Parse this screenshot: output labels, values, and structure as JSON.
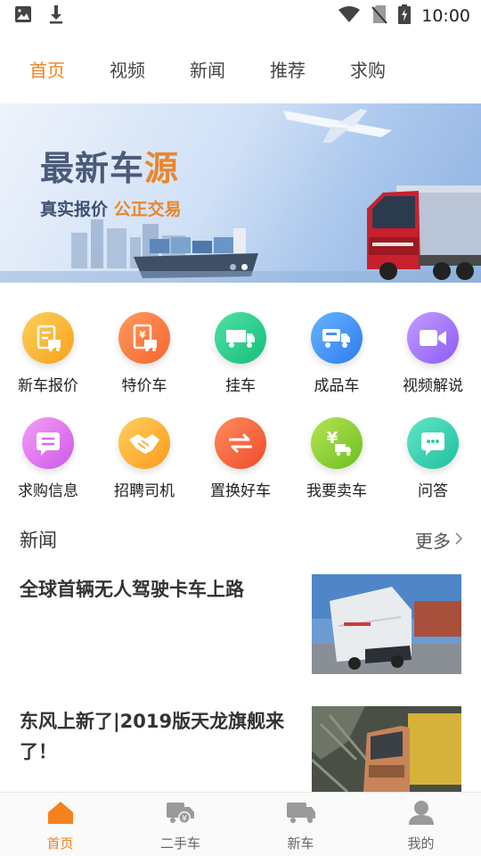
{
  "status_bar": {
    "time": "10:00"
  },
  "top_tabs": [
    "首页",
    "视频",
    "新闻",
    "推荐",
    "求购"
  ],
  "banner": {
    "title_main": "最新车",
    "title_accent": "源",
    "subtitle_main": "真实报价  ",
    "subtitle_accent": "公正交易"
  },
  "features": [
    {
      "label": "新车报价",
      "icon": "quote-icon",
      "color_from": "#fcd05a",
      "color_to": "#f7a21b"
    },
    {
      "label": "特价车",
      "icon": "discount-icon",
      "color_from": "#fd9a5e",
      "color_to": "#f5662e"
    },
    {
      "label": "挂车",
      "icon": "trailer-icon",
      "color_from": "#4fe0a8",
      "color_to": "#17be78"
    },
    {
      "label": "成品车",
      "icon": "finished-truck-icon",
      "color_from": "#66b5ff",
      "color_to": "#2f7bef"
    },
    {
      "label": "视频解说",
      "icon": "video-icon",
      "color_from": "#c39bff",
      "color_to": "#8b5cf6"
    },
    {
      "label": "求购信息",
      "icon": "message-icon",
      "color_from": "#f59ef8",
      "color_to": "#cc59e6"
    },
    {
      "label": "招聘司机",
      "icon": "handshake-icon",
      "color_from": "#ffcf5a",
      "color_to": "#fb9b1e"
    },
    {
      "label": "置换好车",
      "icon": "exchange-icon",
      "color_from": "#ff8c5c",
      "color_to": "#ee4b2b"
    },
    {
      "label": "我要卖车",
      "icon": "sell-truck-icon",
      "color_from": "#b6e354",
      "color_to": "#6cbf1f"
    },
    {
      "label": "问答",
      "icon": "chat-icon",
      "color_from": "#5fe7c8",
      "color_to": "#1fbf9e"
    }
  ],
  "news": {
    "title": "新闻",
    "more": "更多",
    "items": [
      {
        "title": "全球首辆无人驾驶卡车上路"
      },
      {
        "title": "东风上新了|2019版天龙旗舰来了！"
      }
    ]
  },
  "bottom_nav": [
    {
      "label": "首页",
      "icon": "home-icon"
    },
    {
      "label": "二手车",
      "icon": "used-truck-icon"
    },
    {
      "label": "新车",
      "icon": "new-truck-icon"
    },
    {
      "label": "我的",
      "icon": "user-icon"
    }
  ],
  "colors": {
    "accent": "#f5811f",
    "text": "#333333",
    "muted": "#666666"
  }
}
